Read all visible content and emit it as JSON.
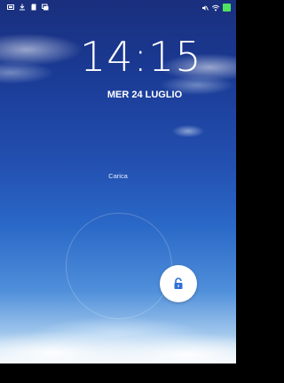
{
  "status_bar": {
    "left_icons": [
      "screenshot-icon",
      "download-icon",
      "sd-card-icon",
      "gallery-icon"
    ],
    "right_icons": [
      "mute-icon",
      "wifi-icon",
      "battery-icon"
    ],
    "battery_color": "#4ee35f"
  },
  "lock_screen": {
    "time": "14:15",
    "date": "MER 24 LUGLIO",
    "charging_label": "Carica"
  },
  "unlock": {
    "icon": "unlock-icon",
    "color": "#2f6fd6"
  }
}
